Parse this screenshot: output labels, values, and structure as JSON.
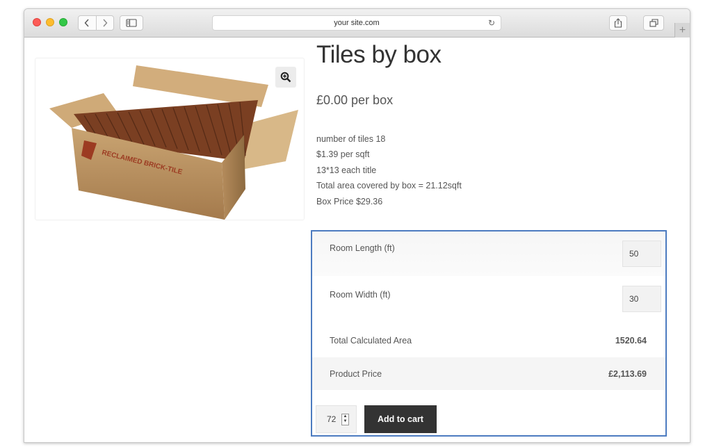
{
  "browser": {
    "address": "your site.com",
    "icons": {
      "back": "chevron-left-icon",
      "forward": "chevron-right-icon",
      "sidebar": "sidebar-icon",
      "reload": "reload-icon",
      "share": "share-icon",
      "tabs": "tabs-overview-icon",
      "new_tab": "plus-icon"
    }
  },
  "product": {
    "title": "Tiles by box",
    "price": "£0.00 per box",
    "image_text": "RECLAIMED BRICK-TILE",
    "description": [
      "number of tiles 18",
      "$1.39 per sqft",
      "13*13 each title",
      "Total area covered by box = 21.12sqft",
      "Box Price $29.36"
    ]
  },
  "calculator": {
    "room_length_label": "Room Length (ft)",
    "room_length_value": "50",
    "room_width_label": "Room Width (ft)",
    "room_width_value": "30",
    "total_area_label": "Total Calculated Area",
    "total_area_value": "1520.64",
    "product_price_label": "Product Price",
    "product_price_value": "£2,113.69",
    "border_color": "#4c7bc0"
  },
  "cart": {
    "quantity": "72",
    "add_to_cart_label": "Add to cart",
    "button_color": "#333333"
  }
}
